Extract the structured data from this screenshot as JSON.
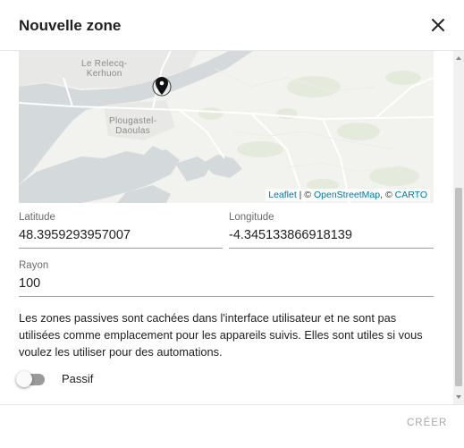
{
  "dialog": {
    "title": "Nouvelle zone",
    "close_icon": "close-icon"
  },
  "map": {
    "places": {
      "relecq_line1": "Le Relecq-",
      "relecq_line2": "Kerhuon",
      "plougastel_line1": "Plougastel-",
      "plougastel_line2": "Daoulas"
    },
    "marker_icon": "map-pin-icon",
    "attribution": {
      "leaflet": "Leaflet",
      "sep1": " | © ",
      "osm": "OpenStreetMap",
      "sep2": ", © ",
      "carto": "CARTO"
    }
  },
  "form": {
    "latitude": {
      "label": "Latitude",
      "value": "48.3959293957007"
    },
    "longitude": {
      "label": "Longitude",
      "value": "-4.345133866918139"
    },
    "radius": {
      "label": "Rayon",
      "value": "100"
    }
  },
  "info_text": "Les zones passives sont cachées dans l'interface utilisateur et ne sont pas utilisées comme emplacement pour les appareils suivis. Elles sont utiles si vous voulez les utiliser pour des automations.",
  "passive": {
    "label": "Passif",
    "checked": false
  },
  "footer": {
    "create_label": "CRÉER"
  },
  "colors": {
    "accent_disabled": "#a8a8a8",
    "water": "#d4dadc",
    "land": "#f2f2ef"
  }
}
